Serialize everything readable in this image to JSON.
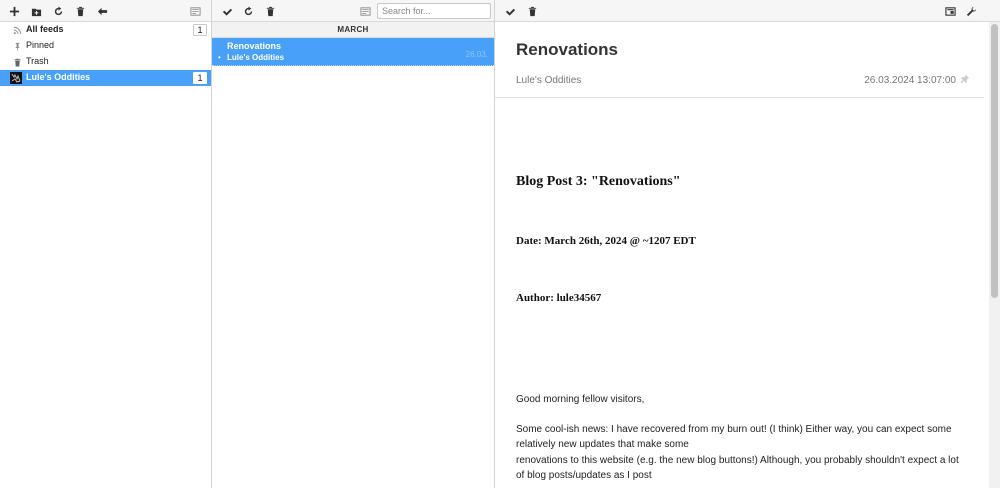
{
  "feeds_toolbar": {
    "icons": [
      "plus-icon",
      "folder-plus-icon",
      "refresh-icon",
      "trash-icon",
      "arrow-left-icon",
      "newspaper-icon"
    ]
  },
  "feeds": [
    {
      "label": "All feeds",
      "count": "1",
      "icon": "rss-icon",
      "bold": true,
      "selected": false
    },
    {
      "label": "Pinned",
      "count": "",
      "icon": "pin-icon",
      "bold": false,
      "selected": false
    },
    {
      "label": "Trash",
      "count": "",
      "icon": "trash-icon",
      "bold": false,
      "selected": false
    },
    {
      "label": "Lule's Oddities",
      "count": "1",
      "icon": "feed-favicon",
      "bold": true,
      "selected": true
    }
  ],
  "list_toolbar": {
    "icons": [
      "checkmark-icon",
      "refresh-icon",
      "trash-icon",
      "newspaper-icon"
    ],
    "search_placeholder": "Search for..."
  },
  "list": {
    "month": "MARCH",
    "entries": [
      {
        "title": "Renovations",
        "feed": "Lule's Oddities",
        "date": "26.03."
      }
    ]
  },
  "article_toolbar": {
    "icons": [
      "checkmark-icon",
      "trash-icon",
      "reader-view-icon",
      "wrench-icon"
    ]
  },
  "article": {
    "title": "Renovations",
    "feed": "Lule's Oddities",
    "date": "26.03.2024 13:07:00",
    "heading1": "Blog Post 3: \"Renovations\"",
    "heading2": "Date: March 26th, 2024 @ ~1207 EDT",
    "heading3": "Author: lule34567",
    "para1": "Good morning fellow visitors,",
    "para2_line1": "Some cool-ish news: I have recovered from my burn out! (I think) Either way, you can expect some",
    "para2_line2": "relatively new updates that make some",
    "para2_line3": "renovations to this website (e.g. the new blog buttons!) Although, you probably shouldn't expect a lot",
    "para2_line4": "of blog posts/updates as I post"
  },
  "colors": {
    "selected": "#48a0f8",
    "toolbar_bg": "#f6f6f6"
  }
}
